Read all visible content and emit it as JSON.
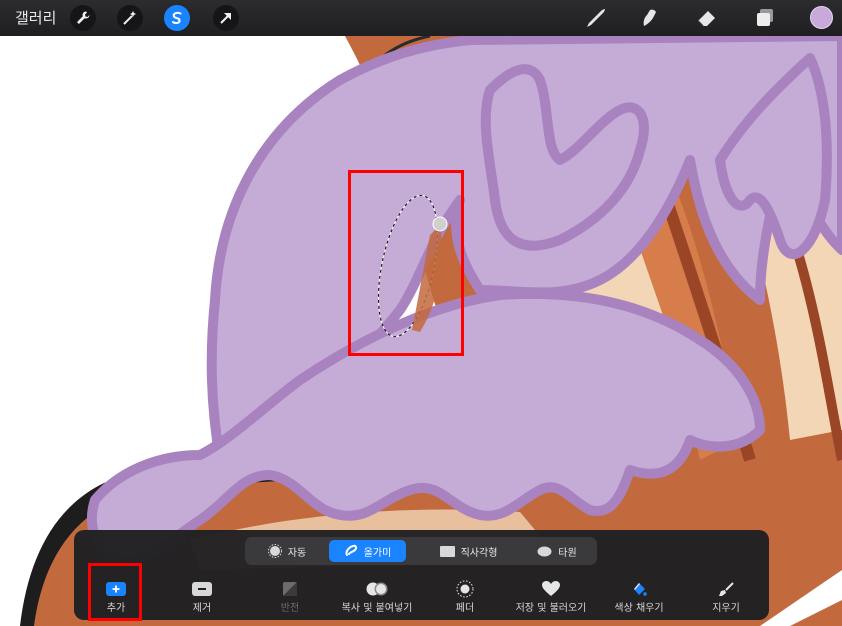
{
  "topbar": {
    "gallery_label": "갤러리",
    "left_tools": [
      {
        "icon": "wrench-icon",
        "active": false
      },
      {
        "icon": "magic-wand-icon",
        "active": false
      },
      {
        "icon": "selection-icon",
        "active": true
      },
      {
        "icon": "transform-arrow-icon",
        "active": false
      }
    ],
    "right_tools": [
      {
        "icon": "brush-icon"
      },
      {
        "icon": "smudge-icon"
      },
      {
        "icon": "eraser-icon"
      },
      {
        "icon": "layers-icon"
      }
    ],
    "current_color": "#c8a9da"
  },
  "selection_modes": [
    {
      "label": "자동",
      "icon": "auto-icon",
      "active": false
    },
    {
      "label": "올가미",
      "icon": "lasso-icon",
      "active": true
    },
    {
      "label": "직사각형",
      "icon": "rectangle-icon",
      "active": false
    },
    {
      "label": "타원",
      "icon": "ellipse-icon",
      "active": false
    }
  ],
  "selection_tools": [
    {
      "label": "추가",
      "icon": "add-icon",
      "active": true,
      "enabled": true
    },
    {
      "label": "제거",
      "icon": "remove-icon",
      "active": false,
      "enabled": true
    },
    {
      "label": "반전",
      "icon": "invert-icon",
      "active": false,
      "enabled": false
    },
    {
      "label": "복사 및 붙여넣기",
      "icon": "copy-paste-icon",
      "active": false,
      "enabled": true
    },
    {
      "label": "페더",
      "icon": "feather-icon",
      "active": false,
      "enabled": true
    },
    {
      "label": "저장 및 불러오기",
      "icon": "heart-icon",
      "active": false,
      "enabled": true
    },
    {
      "label": "색상 채우기",
      "icon": "color-fill-icon",
      "active": false,
      "enabled": true
    },
    {
      "label": "지우기",
      "icon": "clear-icon",
      "active": false,
      "enabled": true
    }
  ],
  "colors": {
    "accent": "#1a84ff",
    "highlight": "#ff0000",
    "lavender": "#c5acd6",
    "lavender_outline": "#a883c0",
    "brown": "#c26a3e",
    "dark_brown": "#9a4526",
    "cream": "#f3d6b6"
  }
}
